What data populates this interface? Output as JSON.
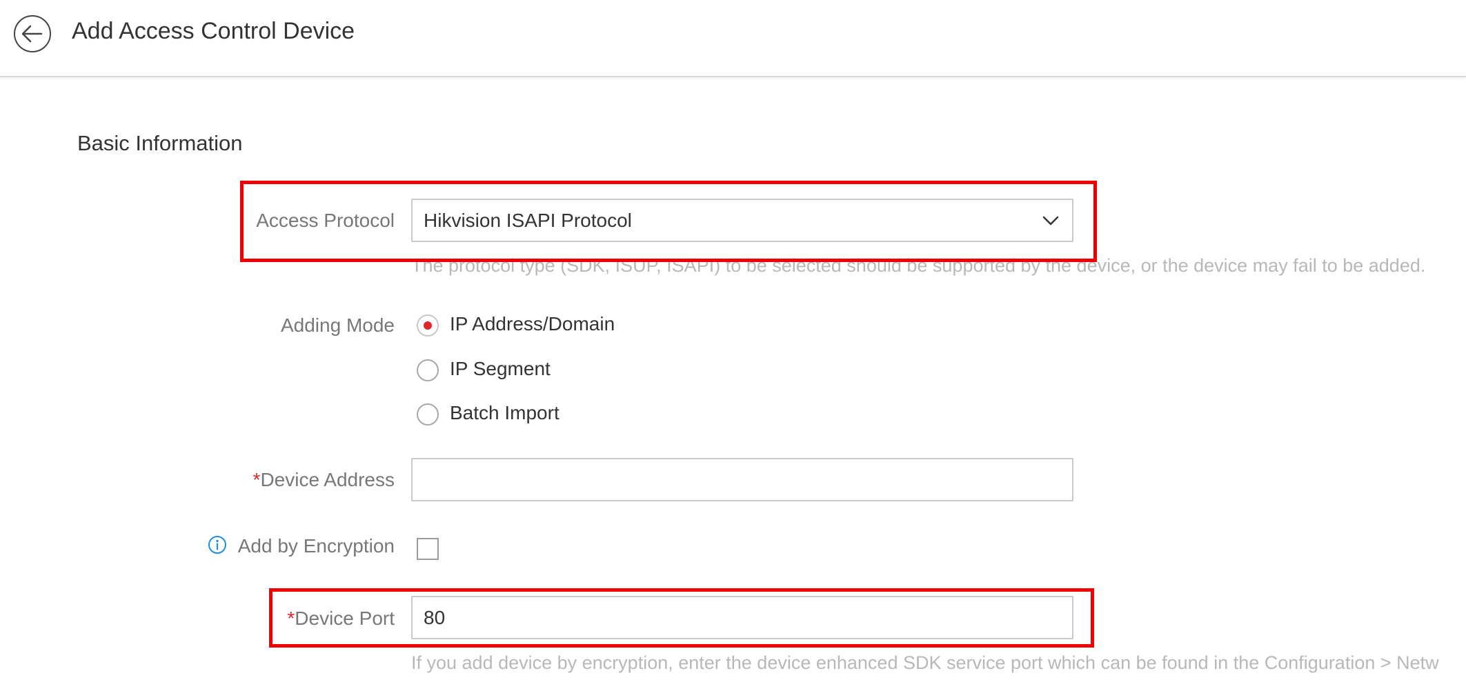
{
  "header": {
    "title": "Add Access Control Device",
    "back_icon": "arrow-left-icon"
  },
  "section": {
    "title": "Basic Information"
  },
  "access_protocol": {
    "label": "Access Protocol",
    "value": "Hikvision ISAPI Protocol",
    "hint": "The protocol type (SDK, ISUP, ISAPI) to be selected should be supported by the device, or the device may fail to be added."
  },
  "adding_mode": {
    "label": "Adding Mode",
    "options": [
      {
        "label": "IP Address/Domain",
        "selected": true
      },
      {
        "label": "IP Segment",
        "selected": false
      },
      {
        "label": "Batch Import",
        "selected": false
      }
    ]
  },
  "device_address": {
    "required_mark": "*",
    "label": "Device Address",
    "value": ""
  },
  "add_by_encryption": {
    "label": "Add by Encryption",
    "checked": false,
    "icon": "info-icon"
  },
  "device_port": {
    "required_mark": "*",
    "label": "Device Port",
    "value": "80",
    "hint": "If you add device by encryption, enter the device enhanced SDK service port which can be found in the Configuration > Netw"
  },
  "colors": {
    "accent_red": "#e0252b",
    "highlight_red": "#ee0000",
    "info_blue": "#1a8fe0"
  }
}
